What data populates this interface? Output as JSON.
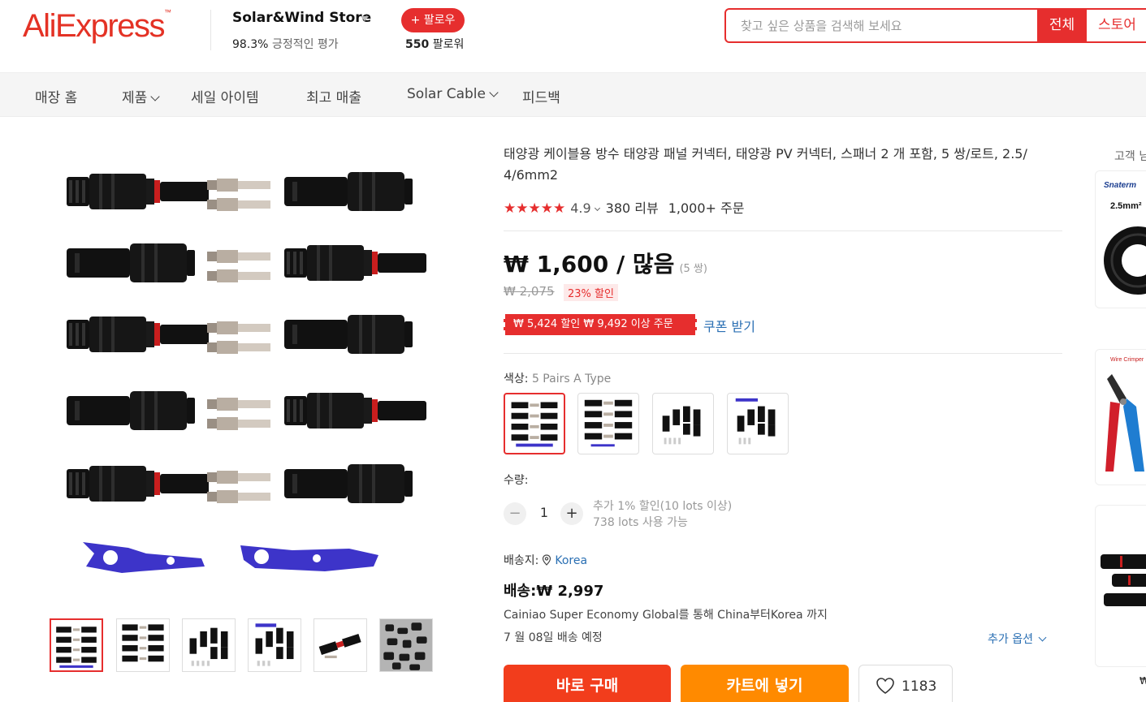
{
  "header": {
    "logo": "AliExpress",
    "logo_tm": "™",
    "store_name": "Solar&Wind Store",
    "rating_pct": "98.3%",
    "rating_label": "긍정적인 평가",
    "follow_label": "+ 팔로우",
    "followers_count": "550",
    "followers_label": "팔로워",
    "search_placeholder": "찾고 싶은 상품을 검색해 보세요",
    "search_all_label": "전체",
    "search_store_label": "스토어"
  },
  "nav": {
    "items": [
      {
        "label": "매장 홈",
        "has_dropdown": false
      },
      {
        "label": "제품",
        "has_dropdown": true
      },
      {
        "label": "세일 아이템",
        "has_dropdown": false
      },
      {
        "label": "최고 매출",
        "has_dropdown": false
      },
      {
        "label": "Solar Cable",
        "has_dropdown": true
      },
      {
        "label": "피드백",
        "has_dropdown": false
      }
    ]
  },
  "product": {
    "title": "태양광 케이블용 방수 태양광 패널 커넥터, 태양광 PV 커넥터, 스패너 2 개 포함, 5 쌍/로트, 2.5/ 4/6mm2",
    "stars": "★★★★★",
    "rating": "4.9",
    "reviews": "380 리뷰",
    "orders": "1,000+ 주문",
    "price": "₩ 1,600 / 많음",
    "price_unit": "(5 쌍)",
    "original_price": "₩ 2,075",
    "discount": "23% 할인",
    "coupon": "₩ 5,424 할인 ₩ 9,492 이상 주문",
    "coupon_link": "쿠폰 받기",
    "color_label": "색상:",
    "color_value": "5 Pairs A Type",
    "qty_label": "수량:",
    "qty_minus": "−",
    "qty_value": "1",
    "qty_plus": "+",
    "qty_note1": "추가 1% 할인(10 lots 이상)",
    "qty_note2": "738 lots 사용 가능",
    "ship_to_label": "배송지:",
    "ship_to_location": "Korea",
    "shipping_cost": "배송:₩ 2,997",
    "ship_method": "Cainiao Super Economy Global를 통해 China부터Korea 까지",
    "delivery": "7 월 08일 배송 예정",
    "more_options": "추가 옵션",
    "buy_now": "바로 구매",
    "add_to_cart": "카트에 넣기",
    "wishlist_count": "1183"
  },
  "recommend": {
    "title": "고객 님",
    "card1_brand": "Snaterm",
    "card1_spec": "2.5mm²",
    "card2_caption": "Wire Crimper",
    "card3_price": "₩"
  },
  "colors": {
    "brand_red": "#e62e2e",
    "buy_now": "#f23d1c",
    "add_cart": "#ff8a00",
    "link_blue": "#2a6fb3",
    "spanner_blue": "#3d34c9"
  }
}
